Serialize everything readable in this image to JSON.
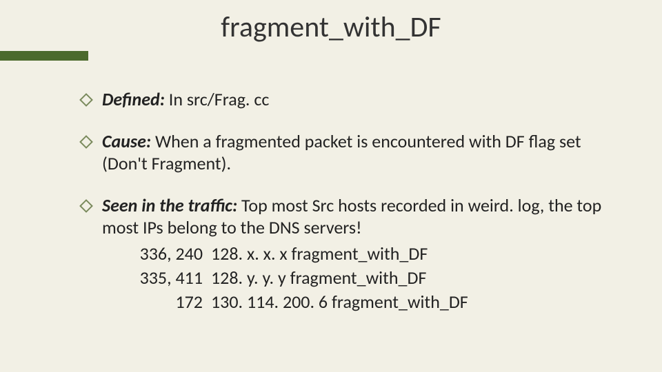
{
  "slide": {
    "title": "fragment_with_DF",
    "bullets": [
      {
        "label": "Defined:",
        "text": " In src/Frag. cc"
      },
      {
        "label": "Cause:",
        "text": " When a fragmented packet is encountered with DF flag set (Don't Fragment)."
      },
      {
        "label": "Seen in the traffic:",
        "text": " Top most Src hosts recorded in weird. log, the top most IPs belong to the DNS servers!"
      }
    ],
    "traffic_rows": [
      {
        "count": "336, 240",
        "ip": "128. x. x. x",
        "event": "fragment_with_DF"
      },
      {
        "count": "335, 411",
        "ip": "128. y. y. y",
        "event": "fragment_with_DF"
      },
      {
        "count": "172",
        "ip": "130. 114. 200. 6",
        "event": "fragment_with_DF"
      }
    ]
  }
}
